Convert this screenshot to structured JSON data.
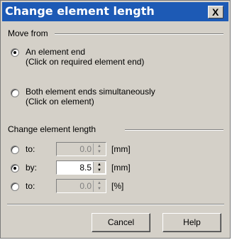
{
  "window": {
    "title": "Change element length",
    "close_glyph": "X"
  },
  "move_from": {
    "group_label": "Move from",
    "options": [
      {
        "line1": "An element end",
        "line2": "(Click on required element end)",
        "selected": true
      },
      {
        "line1": "Both element ends simultaneously",
        "line2": "(Click on element)",
        "selected": false
      }
    ]
  },
  "change_length": {
    "group_label": "Change element length",
    "rows": [
      {
        "prefix": "to:",
        "value": "0.0",
        "unit": "[mm]",
        "selected": false,
        "enabled": false
      },
      {
        "prefix": "by:",
        "value": "8.5",
        "unit": "[mm]",
        "selected": true,
        "enabled": true
      },
      {
        "prefix": "to:",
        "value": "0.0",
        "unit": "[%]",
        "selected": false,
        "enabled": false
      }
    ]
  },
  "buttons": {
    "cancel": "Cancel",
    "help": "Help"
  },
  "icons": {
    "close": "close-icon",
    "spin_up": "spin-up-icon",
    "spin_down": "spin-down-icon"
  }
}
